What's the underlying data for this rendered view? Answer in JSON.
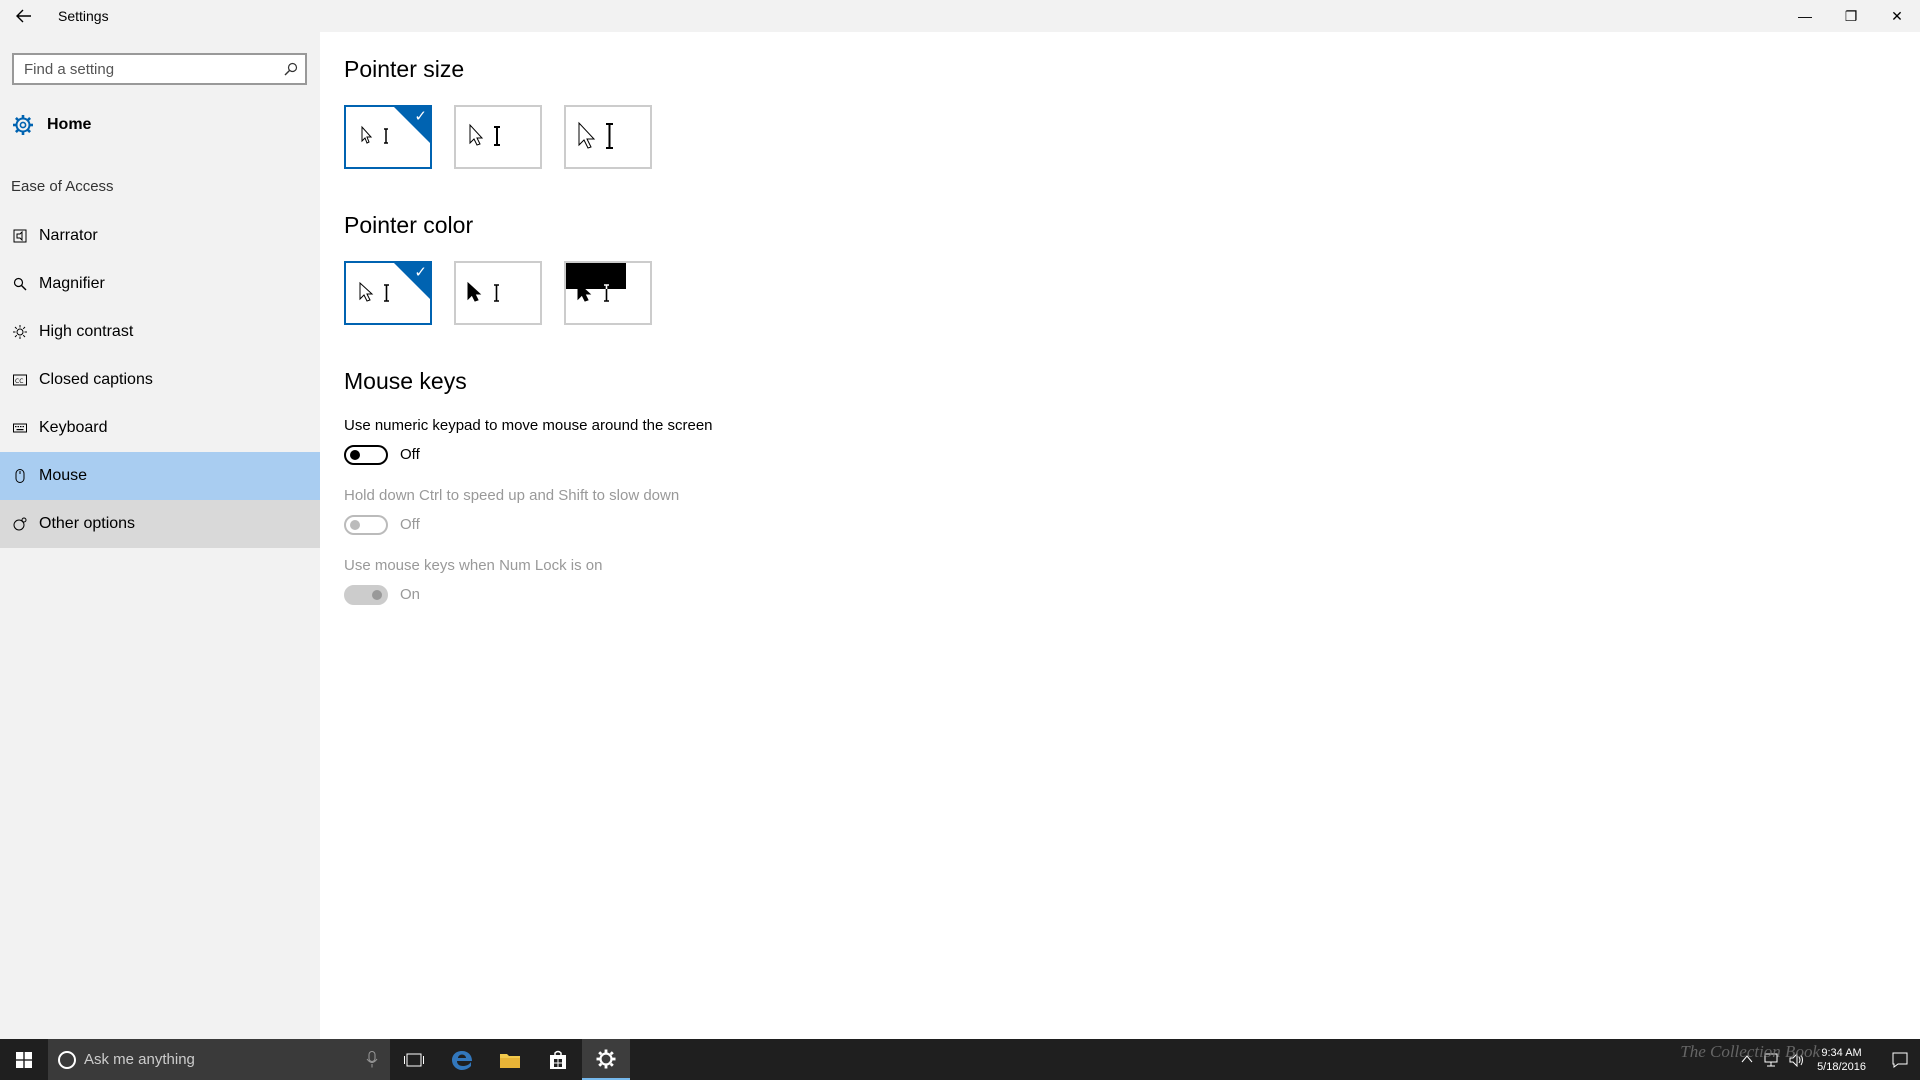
{
  "window": {
    "title": "Settings",
    "back_icon": "back-arrow-icon",
    "minimize_glyph": "—",
    "maximize_glyph": "❐",
    "close_glyph": "✕"
  },
  "sidebar": {
    "search": {
      "placeholder": "Find a setting",
      "value": ""
    },
    "home_label": "Home",
    "section_label": "Ease of Access",
    "items": [
      {
        "label": "Narrator",
        "icon": "narrator-icon"
      },
      {
        "label": "Magnifier",
        "icon": "magnifier-icon"
      },
      {
        "label": "High contrast",
        "icon": "high-contrast-icon"
      },
      {
        "label": "Closed captions",
        "icon": "closed-captions-icon"
      },
      {
        "label": "Keyboard",
        "icon": "keyboard-icon"
      },
      {
        "label": "Mouse",
        "icon": "mouse-icon",
        "selected": true
      },
      {
        "label": "Other options",
        "icon": "other-options-icon"
      }
    ]
  },
  "main": {
    "pointer_size": {
      "heading": "Pointer size",
      "selected_index": 0
    },
    "pointer_color": {
      "heading": "Pointer color",
      "selected_index": 0
    },
    "mouse_keys": {
      "heading": "Mouse keys",
      "settings": [
        {
          "description": "Use numeric keypad to move mouse around the screen",
          "state": "Off",
          "enabled": true
        },
        {
          "description": "Hold down Ctrl to speed up and Shift to slow down",
          "state": "Off",
          "enabled": false
        },
        {
          "description": "Use mouse keys when Num Lock is on",
          "state": "On",
          "enabled": false
        }
      ]
    }
  },
  "taskbar": {
    "search_placeholder": "Ask me anything",
    "time": "9:34 AM",
    "date": "5/18/2016",
    "watermark": "The Collection Book"
  },
  "colors": {
    "accent": "#0063b1",
    "selected_nav": "#a9cdf1",
    "sidebar_bg": "#f2f2f2",
    "taskbar_bg": "#1f1f1f"
  }
}
